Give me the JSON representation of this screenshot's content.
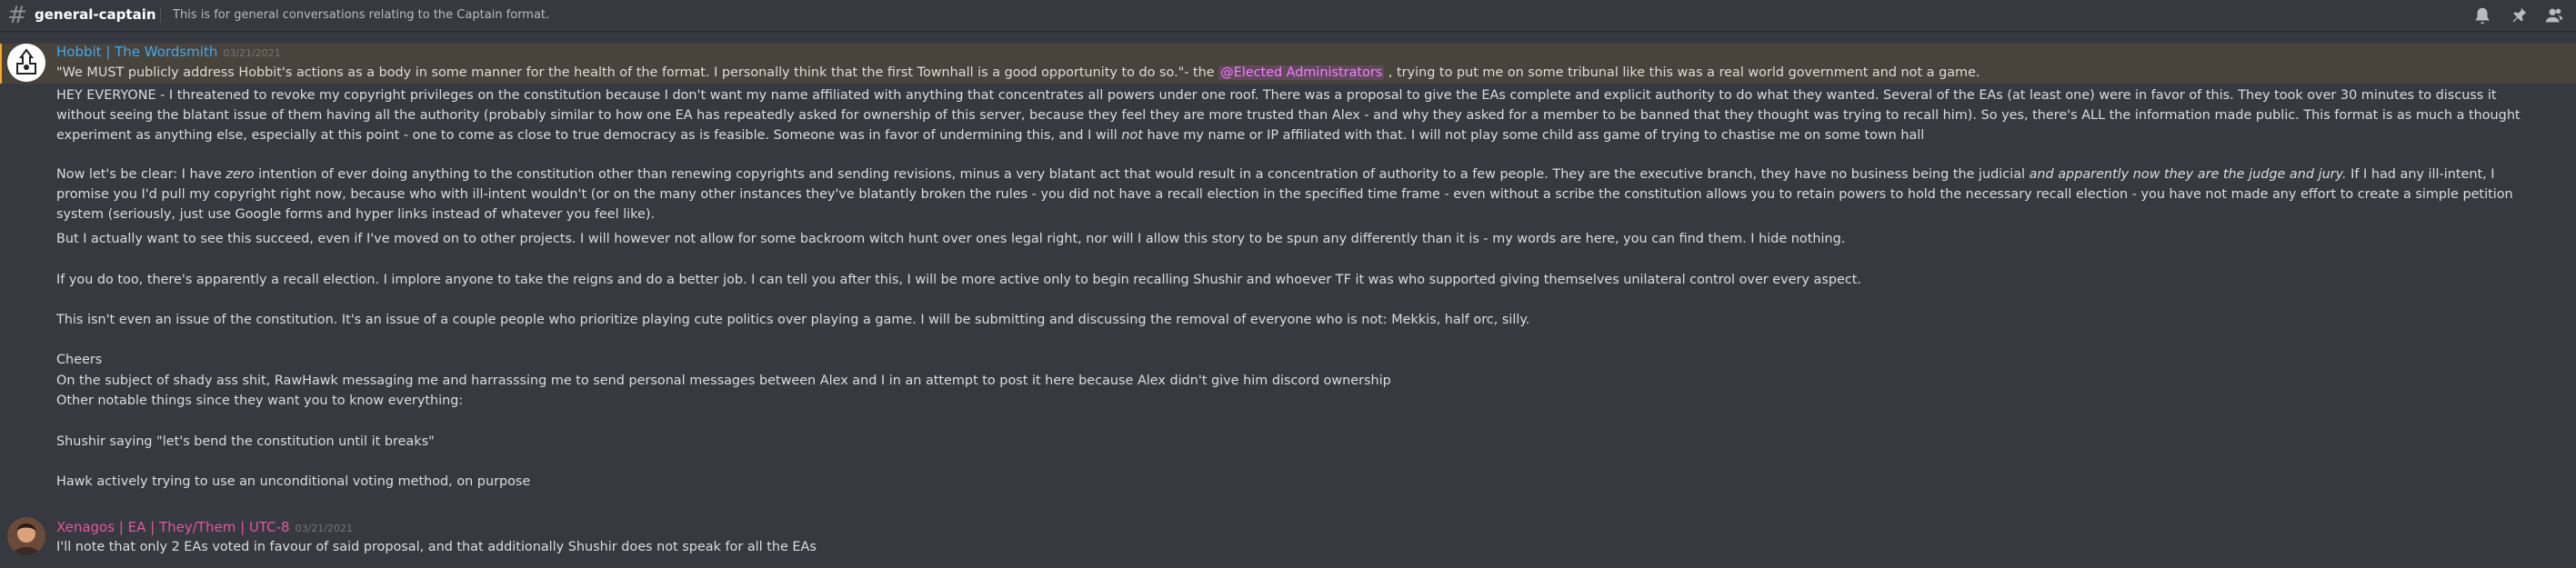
{
  "header": {
    "channel_name": "general-captain",
    "topic": "This is for general conversations relating to the Captain format."
  },
  "message1": {
    "author": "Hobbit | The Wordsmith",
    "author_color": "#3fa9f5",
    "timestamp": "03/21/2021",
    "quote_before": "\"We MUST publicly address Hobbit's actions as a body in some manner for the health of the format. I personally think that the first Townhall is a good opportunity to do so.\"- the ",
    "mention": "@Elected Administrators",
    "quote_after": " , trying to put me on some tribunal like this was a real world government and not a game.",
    "p1": "HEY EVERYONE - I threatened to revoke my copyright privileges on the constitution because I don't want my name affiliated with anything that concentrates all powers under one roof. There was a proposal to give the EAs complete and explicit authority to do what they wanted. Several of the EAs (at least one) were in favor of this. They took over 30 minutes to discuss it without seeing the blatant issue of them having all the authority (probably similar to how one EA has repeatedly asked for ownership of this server, because they feel they are more trusted than Alex - and why they asked for a member to be banned that they thought was trying to recall him). So yes, there's ALL the information made public. This format is as much a thought experiment as anything else, especially at this point - one to come as close to true democracy as is feasible. Someone was in favor of undermining this, and I will ",
    "p1_em": "not",
    "p1_end": " have my name or IP affiliated with that. I will not play some child ass game of trying to chastise me on some town hall",
    "p2_a": "Now let's be clear: I have ",
    "p2_em1": "zero",
    "p2_b": " intention of ever doing anything to the constitution other than renewing copyrights and sending revisions, minus a very blatant act that would result in a concentration of authority to a few people. They are the executive branch, they have no business being the judicial ",
    "p2_em2": "and apparently now they are the judge and jury.",
    "p2_c": " If I had any ill-intent, I promise you I'd pull my copyright right now, because who with ill-intent wouldn't (or on the many other instances they've blatantly broken the rules - you did not have a recall election in the specified time frame - even without a scribe the constitution allows you to retain powers to hold the necessary recall election - you have not made any effort to create a simple petition system (seriously, just use Google forms and hyper links instead of whatever you feel like).",
    "p3": "But I actually want to see this succeed, even if I've moved on to other projects. I will however not allow for some backroom witch hunt over ones legal right, nor will I allow this story to be spun any differently than it is - my words are here, you can find them. I hide nothing.",
    "p4": "If you do too, there's apparently a recall election. I implore anyone to take the reigns and do a better job. I can tell you after this, I will be more active only to begin recalling Shushir and whoever TF it was who supported giving themselves unilateral control over every aspect.",
    "p5": "This isn't even an issue of the constitution. It's an issue of a couple people who prioritize playing cute politics over playing a game. I will be submitting and discussing the removal of everyone who is not: Mekkis, half orc, silly.",
    "p6": "Cheers",
    "p7": "On the subject of shady ass shit, RawHawk messaging me and harrasssing me to send personal messages between Alex and I in an attempt to post it here because Alex didn't give him discord ownership",
    "p8": "Other notable things since they want you to know everything:",
    "p9": "Shushir saying \"let's bend the constitution until it breaks\"",
    "p10": "Hawk actively trying to use an unconditional voting method, on purpose"
  },
  "message2": {
    "author": "Xenagos | EA | They/Them | UTC-8",
    "author_color": "#e0599c",
    "timestamp": "03/21/2021",
    "text": "I'll note that only 2 EAs voted in favour of said proposal, and that additionally Shushir does not speak for all the EAs"
  }
}
